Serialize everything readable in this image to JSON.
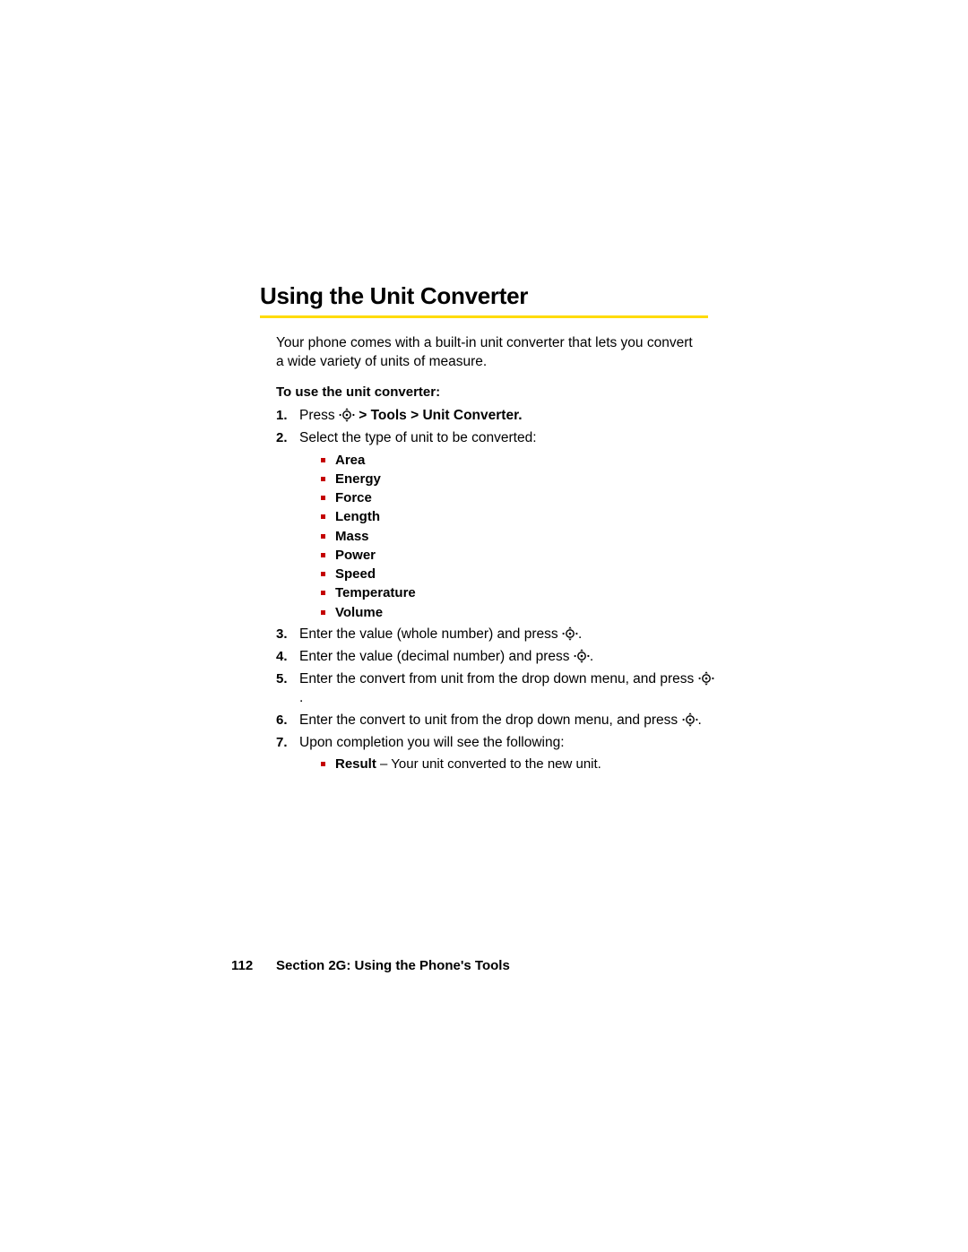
{
  "heading": "Using the Unit Converter",
  "intro": "Your phone comes with a built-in unit converter that lets you convert a wide variety of units of measure.",
  "subhead": "To use the unit converter:",
  "steps": {
    "s1_press": "Press",
    "s1_path": " > Tools > Unit Converter.",
    "s2": "Select the type of unit to be converted:",
    "units": [
      "Area",
      "Energy",
      "Force",
      "Length",
      "Mass",
      "Power",
      "Speed",
      "Temperature",
      "Volume"
    ],
    "s3_a": "Enter the value (whole number) and press ",
    "s3_b": ".",
    "s4_a": "Enter the value (decimal number) and press ",
    "s4_b": ".",
    "s5_a": "Enter the convert from unit from the drop down menu, and press ",
    "s5_b": ".",
    "s6_a": "Enter the convert to unit from the drop down menu, and press ",
    "s6_b": ".",
    "s7": "Upon completion you will see the following:",
    "result_label": "Result",
    "result_text": " – Your unit converted to the new unit."
  },
  "footer": {
    "page": "112",
    "section": "Section 2G: Using the Phone's Tools"
  }
}
